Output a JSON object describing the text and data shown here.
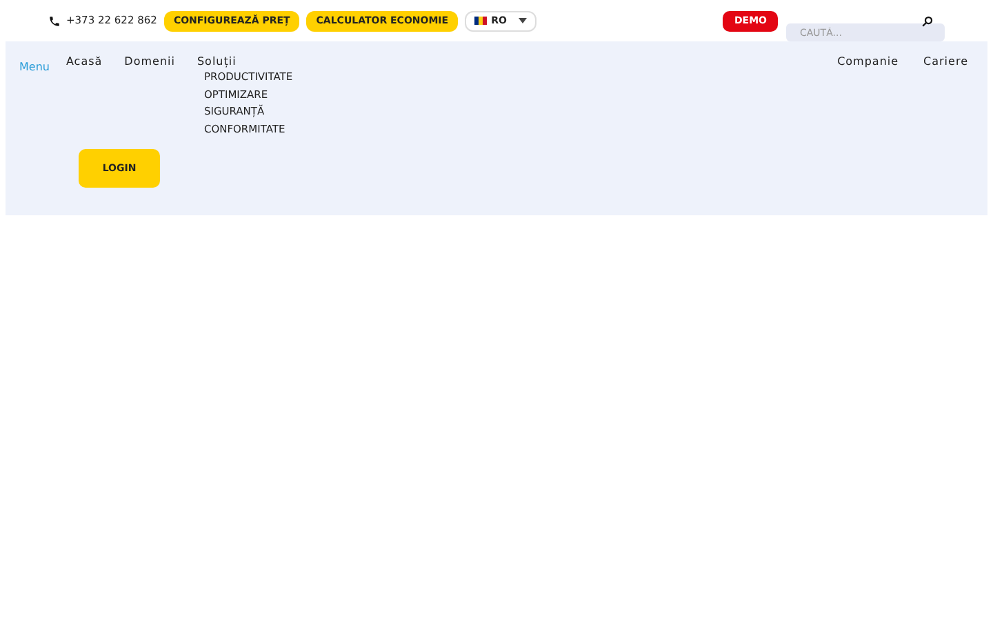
{
  "top_bar": {
    "phone": "+373 22 622 862",
    "buttons": [
      "CONFIGUREAZĂ PREȚ",
      "CALCULATOR ECONOMIE"
    ],
    "language": {
      "label": "RO"
    },
    "demo": "DEMO",
    "search": {
      "placeholder": "CAUTĂ..."
    }
  },
  "nav": {
    "menu_label": "Menu",
    "items": [
      {
        "label": "Acasă"
      },
      {
        "label": "Domenii"
      },
      {
        "label": "Soluții",
        "children": [
          {
            "label": "PRODUCTIVITATE"
          },
          {
            "label": "OPTIMIZARE"
          },
          {
            "label": "SIGURANȚĂ"
          },
          {
            "label": "CONFORMITATE"
          }
        ]
      }
    ],
    "right_items": [
      "Companie",
      "Cariere"
    ],
    "login": "LOGIN"
  }
}
